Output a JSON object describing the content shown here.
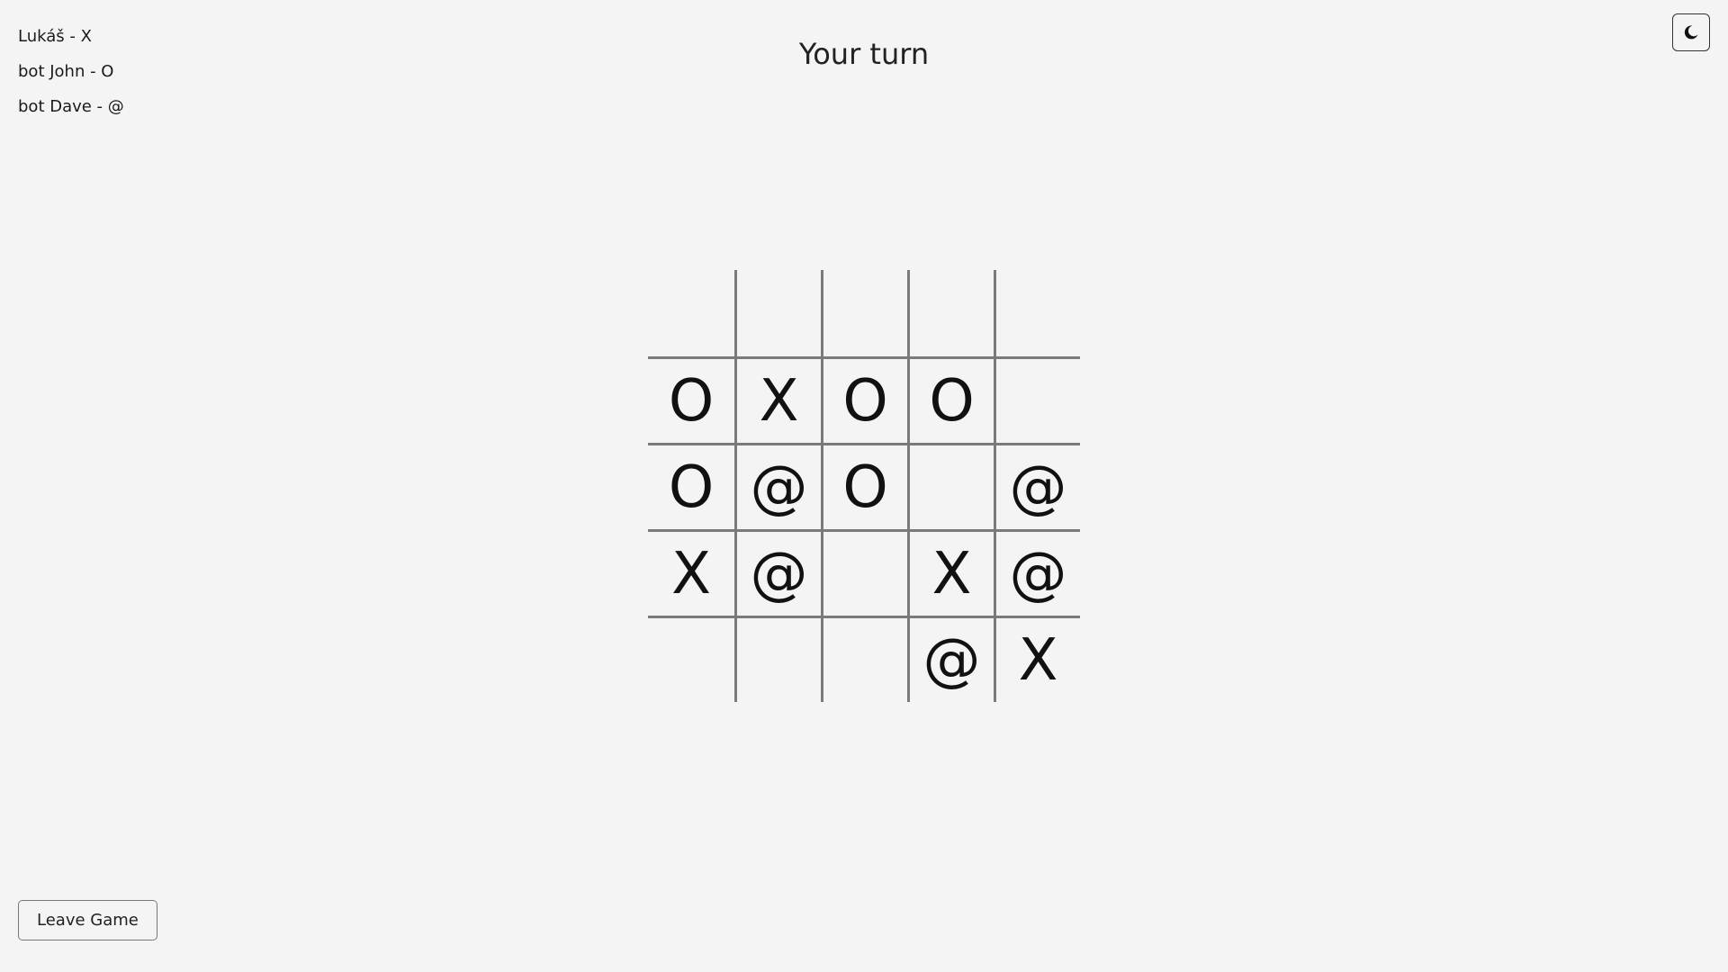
{
  "players": [
    {
      "label": "Lukáš - X"
    },
    {
      "label": "bot John - O"
    },
    {
      "label": "bot Dave - @"
    }
  ],
  "status": "Your turn",
  "theme_toggle": {
    "icon": "moon-icon"
  },
  "board": {
    "rows": 5,
    "cols": 5,
    "cells": [
      [
        "",
        "",
        "",
        "",
        ""
      ],
      [
        "O",
        "X",
        "O",
        "O",
        ""
      ],
      [
        "O",
        "@",
        "O",
        "",
        "@"
      ],
      [
        "X",
        "@",
        "",
        "X",
        "@"
      ],
      [
        "",
        "",
        "",
        "@",
        "X"
      ]
    ]
  },
  "leave_button": "Leave Game"
}
